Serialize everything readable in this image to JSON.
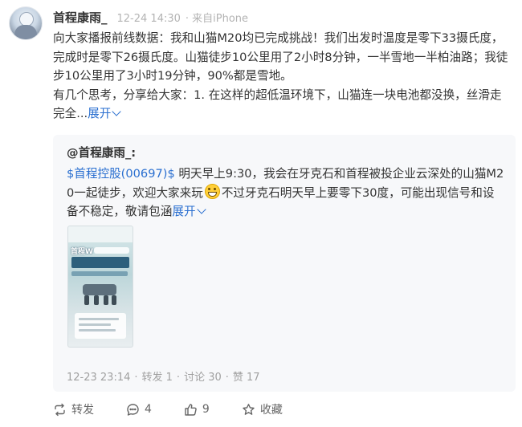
{
  "post": {
    "username": "首程康雨_",
    "time": "12-24 14:30",
    "source": "· 来自iPhone",
    "paragraph1": "向大家播报前线数据：我和山猫M20均已完成挑战！我们出发时温度是零下33摄氏度，完成时是零下26摄氏度。山猫徒步10公里用了2小时8分钟，一半雪地一半柏油路；我徒步10公里用了3小时19分钟，90%都是雪地。",
    "paragraph2": "有几个思考，分享给大家：1. 在这样的超低温环境下，山猫连一块电池都没换，丝滑走完全...",
    "expand_label": "展开"
  },
  "repost": {
    "author": "@首程康雨_:",
    "stock_tag": "$首程控股(00697)$",
    "text_a": " 明天早上9:30，我会在牙克石和首程被投企业云深处的山猫M20一起徒步，欢迎大家来玩",
    "text_b": "不过牙克石明天早上要零下30度，可能出现信号和设备不稳定，敬请包涵",
    "expand_label": "展开",
    "emoji_icon": "grinning-face-icon",
    "thumbnail": {
      "brand": "首程W"
    },
    "time": "12-23 23:14",
    "repost_stat": "转发 1",
    "comment_stat": "讨论 30",
    "like_stat": "赞 17"
  },
  "actions": {
    "repost_label": "转发",
    "comment_count": "4",
    "like_count": "9",
    "favorite_label": "收藏"
  },
  "colors": {
    "link": "#2a6fd0",
    "meta": "#a0a0a0",
    "card_bg": "#f7f8fa"
  }
}
